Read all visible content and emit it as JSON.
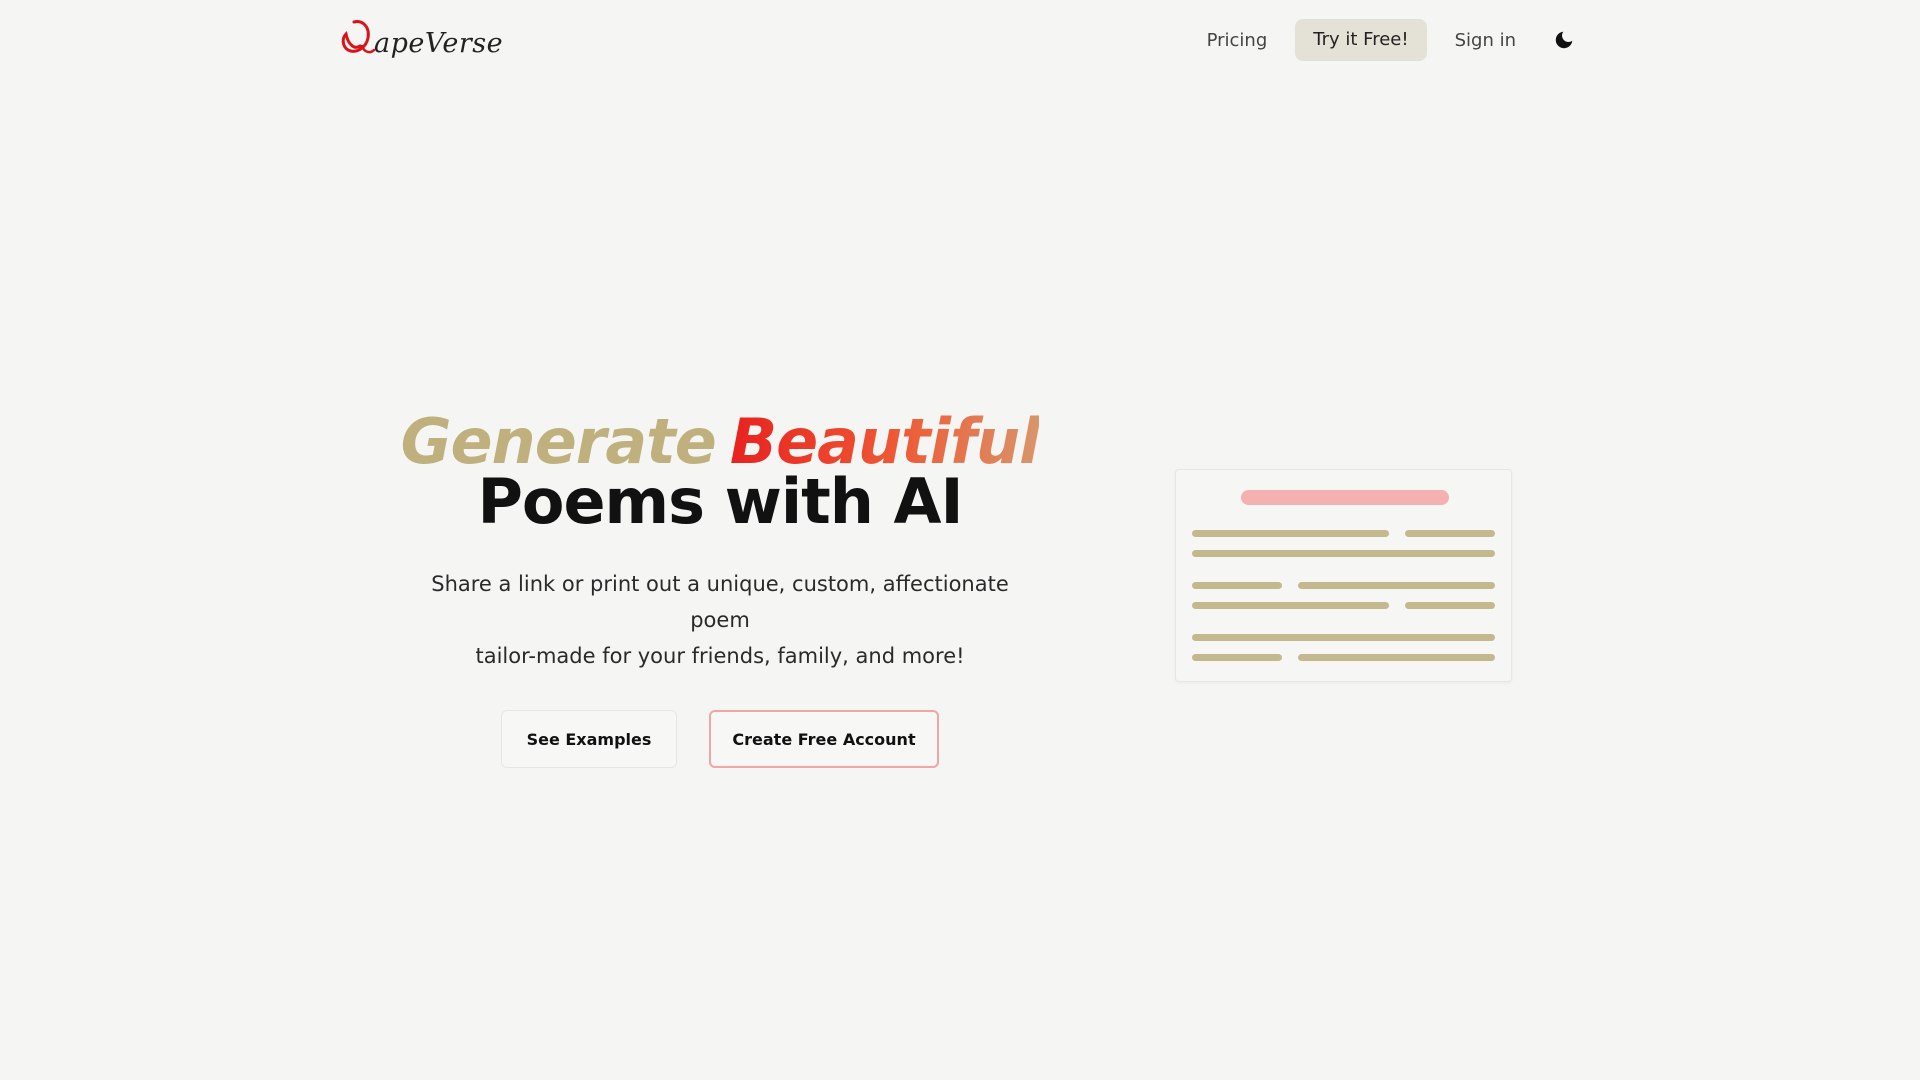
{
  "header": {
    "logo_text": "apeVerse",
    "nav": {
      "pricing": "Pricing",
      "cta": "Try it Free!",
      "signin": "Sign in"
    },
    "theme_icon": "moon-icon"
  },
  "hero": {
    "headline_word1": "Generate",
    "headline_word2": "Beautiful",
    "headline_line2": "Poems with AI",
    "subtitle_line1": "Share a link or print out a unique, custom, affectionate poem",
    "subtitle_line2": "tailor-made for your friends, family, and more!",
    "buttons": {
      "examples": "See Examples",
      "create": "Create Free Account"
    }
  },
  "colors": {
    "background": "#f5f5f3",
    "accent_gold": "#bfb07e",
    "accent_red": "#e8221f",
    "cta_border": "#f2a5a5",
    "nav_cta_bg": "#e4e1d6"
  }
}
